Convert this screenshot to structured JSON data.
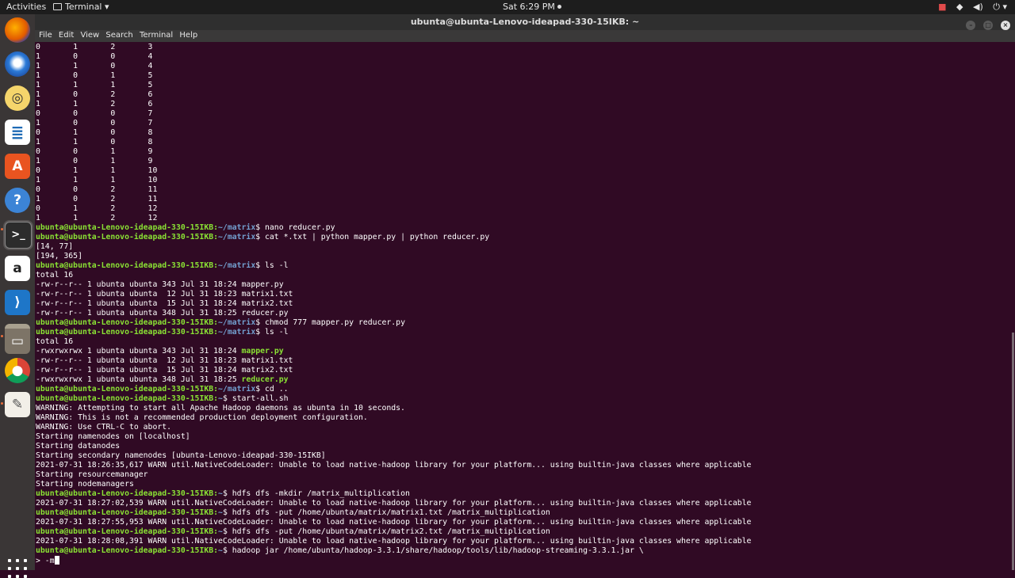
{
  "topbar": {
    "activities": "Activities",
    "app_menu": "Terminal ▾",
    "clock": "Sat  6:29 PM",
    "tray_icons": [
      "record-icon",
      "network-icon",
      "volume-icon",
      "power-icon"
    ]
  },
  "dock": {
    "apps": [
      "firefox",
      "thunderbird",
      "rhythmbox",
      "libreoffice-writer",
      "software-center",
      "help",
      "terminal",
      "amazon",
      "vscode",
      "files",
      "chrome",
      "text-editor"
    ]
  },
  "window": {
    "title": "ubunta@ubunta-Lenovo-ideapad-330-15IKB: ~",
    "menu": [
      "File",
      "Edit",
      "View",
      "Search",
      "Terminal",
      "Help"
    ]
  },
  "terminal": {
    "prompt_user": "ubunta@ubunta-Lenovo-ideapad-330-15IKB",
    "lines": [
      {
        "type": "text",
        "text": "0       1       2       3"
      },
      {
        "type": "text",
        "text": "1       0       0       4"
      },
      {
        "type": "text",
        "text": "1       1       0       4"
      },
      {
        "type": "text",
        "text": "1       0       1       5"
      },
      {
        "type": "text",
        "text": "1       1       1       5"
      },
      {
        "type": "text",
        "text": "1       0       2       6"
      },
      {
        "type": "text",
        "text": "1       1       2       6"
      },
      {
        "type": "text",
        "text": "0       0       0       7"
      },
      {
        "type": "text",
        "text": "1       0       0       7"
      },
      {
        "type": "text",
        "text": "0       1       0       8"
      },
      {
        "type": "text",
        "text": "1       1       0       8"
      },
      {
        "type": "text",
        "text": "0       0       1       9"
      },
      {
        "type": "text",
        "text": "1       0       1       9"
      },
      {
        "type": "text",
        "text": "0       1       1       10"
      },
      {
        "type": "text",
        "text": "1       1       1       10"
      },
      {
        "type": "text",
        "text": "0       0       2       11"
      },
      {
        "type": "text",
        "text": "1       0       2       11"
      },
      {
        "type": "text",
        "text": "0       1       2       12"
      },
      {
        "type": "text",
        "text": "1       1       2       12"
      },
      {
        "type": "prompt",
        "path": "~/matrix",
        "cmd": " nano reducer.py"
      },
      {
        "type": "prompt",
        "path": "~/matrix",
        "cmd": " cat *.txt | python mapper.py | python reducer.py"
      },
      {
        "type": "text",
        "text": "[14, 77]"
      },
      {
        "type": "text",
        "text": "[194, 365]"
      },
      {
        "type": "prompt",
        "path": "~/matrix",
        "cmd": " ls -l"
      },
      {
        "type": "text",
        "text": "total 16"
      },
      {
        "type": "text",
        "text": "-rw-r--r-- 1 ubunta ubunta 343 Jul 31 18:24 mapper.py"
      },
      {
        "type": "text",
        "text": "-rw-r--r-- 1 ubunta ubunta  12 Jul 31 18:23 matrix1.txt"
      },
      {
        "type": "text",
        "text": "-rw-r--r-- 1 ubunta ubunta  15 Jul 31 18:24 matrix2.txt"
      },
      {
        "type": "text",
        "text": "-rw-r--r-- 1 ubunta ubunta 348 Jul 31 18:25 reducer.py"
      },
      {
        "type": "prompt",
        "path": "~/matrix",
        "cmd": " chmod 777 mapper.py reducer.py"
      },
      {
        "type": "prompt",
        "path": "~/matrix",
        "cmd": " ls -l"
      },
      {
        "type": "text",
        "text": "total 16"
      },
      {
        "type": "file",
        "text": "-rwxrwxrwx 1 ubunta ubunta 343 Jul 31 18:24 ",
        "name": "mapper.py"
      },
      {
        "type": "text",
        "text": "-rw-r--r-- 1 ubunta ubunta  12 Jul 31 18:23 matrix1.txt"
      },
      {
        "type": "text",
        "text": "-rw-r--r-- 1 ubunta ubunta  15 Jul 31 18:24 matrix2.txt"
      },
      {
        "type": "file",
        "text": "-rwxrwxrwx 1 ubunta ubunta 348 Jul 31 18:25 ",
        "name": "reducer.py"
      },
      {
        "type": "prompt",
        "path": "~/matrix",
        "cmd": " cd .."
      },
      {
        "type": "prompt",
        "path": "~",
        "cmd": " start-all.sh"
      },
      {
        "type": "text",
        "text": "WARNING: Attempting to start all Apache Hadoop daemons as ubunta in 10 seconds."
      },
      {
        "type": "text",
        "text": "WARNING: This is not a recommended production deployment configuration."
      },
      {
        "type": "text",
        "text": "WARNING: Use CTRL-C to abort."
      },
      {
        "type": "text",
        "text": "Starting namenodes on [localhost]"
      },
      {
        "type": "text",
        "text": "Starting datanodes"
      },
      {
        "type": "text",
        "text": "Starting secondary namenodes [ubunta-Lenovo-ideapad-330-15IKB]"
      },
      {
        "type": "text",
        "text": "2021-07-31 18:26:35,617 WARN util.NativeCodeLoader: Unable to load native-hadoop library for your platform... using builtin-java classes where applicable"
      },
      {
        "type": "text",
        "text": "Starting resourcemanager"
      },
      {
        "type": "text",
        "text": "Starting nodemanagers"
      },
      {
        "type": "prompt",
        "path": "~",
        "cmd": " hdfs dfs -mkdir /matrix_multiplication"
      },
      {
        "type": "text",
        "text": "2021-07-31 18:27:02,539 WARN util.NativeCodeLoader: Unable to load native-hadoop library for your platform... using builtin-java classes where applicable"
      },
      {
        "type": "prompt",
        "path": "~",
        "cmd": " hdfs dfs -put /home/ubunta/matrix/matrix1.txt /matrix_multiplication"
      },
      {
        "type": "text",
        "text": "2021-07-31 18:27:55,953 WARN util.NativeCodeLoader: Unable to load native-hadoop library for your platform... using builtin-java classes where applicable"
      },
      {
        "type": "prompt",
        "path": "~",
        "cmd": " hdfs dfs -put /home/ubunta/matrix/matrix2.txt /matrix_multiplication"
      },
      {
        "type": "text",
        "text": "2021-07-31 18:28:08,391 WARN util.NativeCodeLoader: Unable to load native-hadoop library for your platform... using builtin-java classes where applicable"
      },
      {
        "type": "prompt",
        "path": "~",
        "cmd": " hadoop jar /home/ubunta/hadoop-3.3.1/share/hadoop/tools/lib/hadoop-streaming-3.3.1.jar \\"
      },
      {
        "type": "input",
        "text": "> -m"
      }
    ]
  }
}
